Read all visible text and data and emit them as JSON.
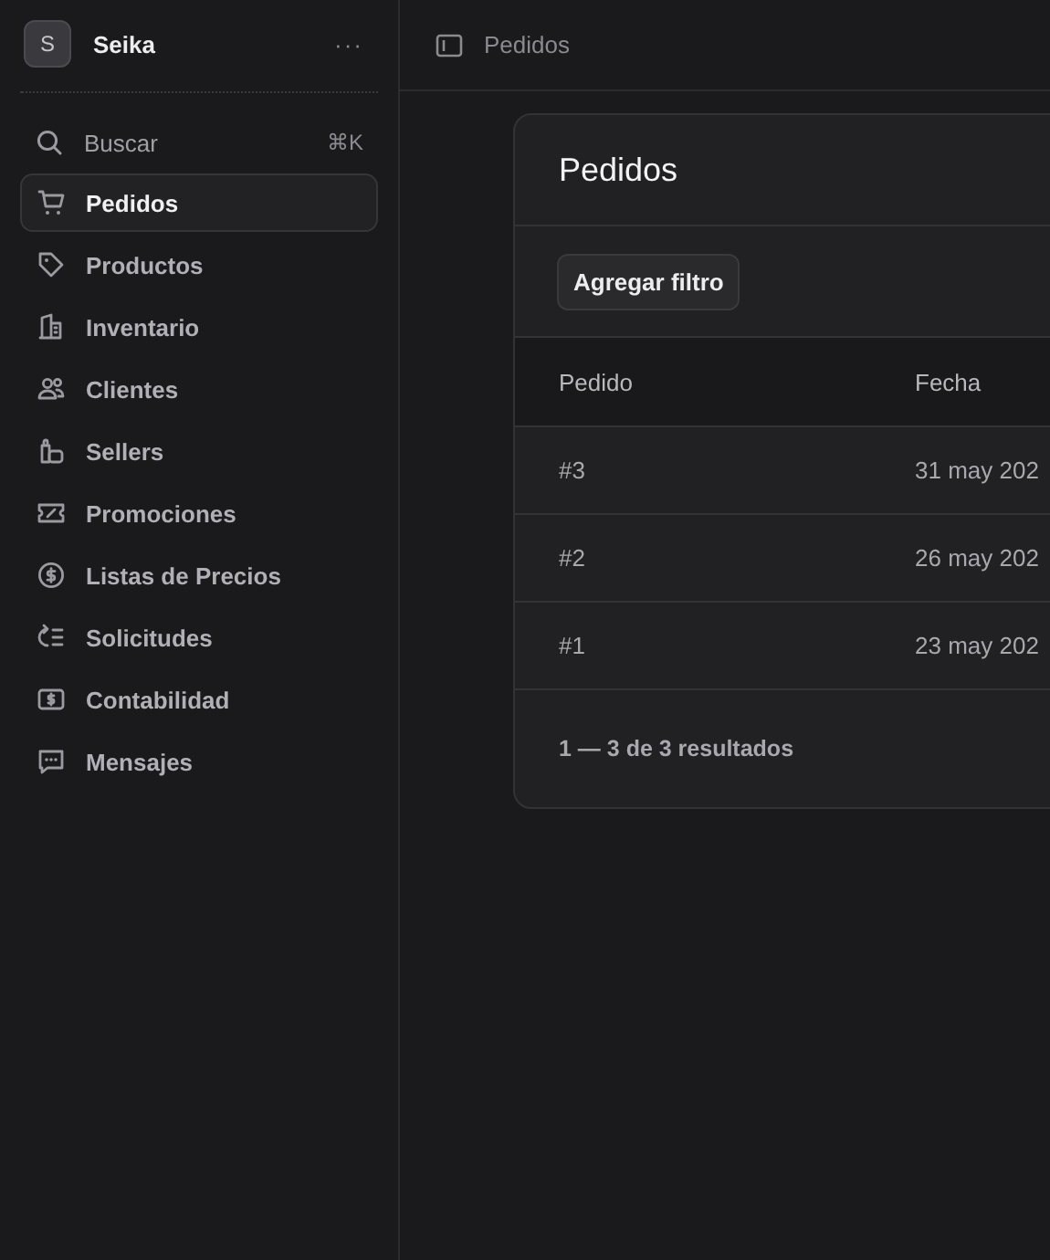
{
  "workspace": {
    "initial": "S",
    "name": "Seika",
    "menu": "···"
  },
  "search": {
    "label": "Buscar",
    "shortcut": "⌘K"
  },
  "nav": [
    {
      "label": "Pedidos",
      "selected": true
    },
    {
      "label": "Productos",
      "selected": false
    },
    {
      "label": "Inventario",
      "selected": false
    },
    {
      "label": "Clientes",
      "selected": false
    },
    {
      "label": "Sellers",
      "selected": false
    },
    {
      "label": "Promociones",
      "selected": false
    },
    {
      "label": "Listas de Precios",
      "selected": false
    },
    {
      "label": "Solicitudes",
      "selected": false
    },
    {
      "label": "Contabilidad",
      "selected": false
    },
    {
      "label": "Mensajes",
      "selected": false
    }
  ],
  "breadcrumb": "Pedidos",
  "card": {
    "title": "Pedidos",
    "filter_button": "Agregar filtro",
    "table": {
      "columns": [
        "Pedido",
        "Fecha"
      ],
      "rows": [
        [
          "#3",
          "31 may 202"
        ],
        [
          "#2",
          "26 may 202"
        ],
        [
          "#1",
          "23 may 202"
        ]
      ]
    },
    "pagination": "1 — 3 de 3 resultados"
  }
}
